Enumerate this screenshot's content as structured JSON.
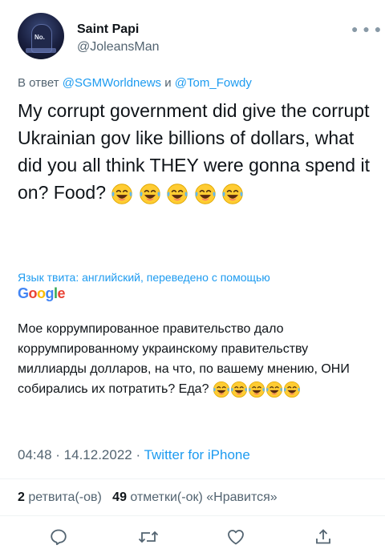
{
  "author": {
    "name": "Saint Papi",
    "handle": "@JoleansMan",
    "avatar_text": "No."
  },
  "reply_to": {
    "prefix": "В ответ",
    "mention1": "@SGMWorldnews",
    "conj": "и",
    "mention2": "@Tom_Fowdy"
  },
  "tweet": {
    "text": "My corrupt government did give the corrupt Ukrainian gov like billions of dollars, what did you all think THEY were gonna spend it on? Food?",
    "emoji": "face-with-tears-of-joy x5"
  },
  "translation": {
    "label": "Язык твита: английский, переведено с помощью",
    "provider": "Google",
    "text": "Мое коррумпированное правительство дало коррумпированному украинскому правительству миллиарды долларов, на что, по вашему мнению, ОНИ собирались их потратить? Еда?"
  },
  "meta": {
    "time": "04:48",
    "sep1": " · ",
    "date": "14.12.2022",
    "sep2": " · ",
    "app": "Twitter for iPhone"
  },
  "stats": {
    "retweets": "2",
    "retweets_label": "ретвита(-ов)",
    "likes": "49",
    "likes_label": "отметки(-ок) «Нравится»"
  },
  "icons": {
    "more": "more-dots-icon",
    "reply": "reply-icon",
    "retweet": "retweet-icon",
    "like": "heart-icon",
    "share": "share-icon"
  },
  "colors": {
    "accent": "#1d9bf0",
    "secondary_text": "#536471",
    "emoji_face": "#ffcc33",
    "emoji_tear": "#5fb8f0"
  }
}
